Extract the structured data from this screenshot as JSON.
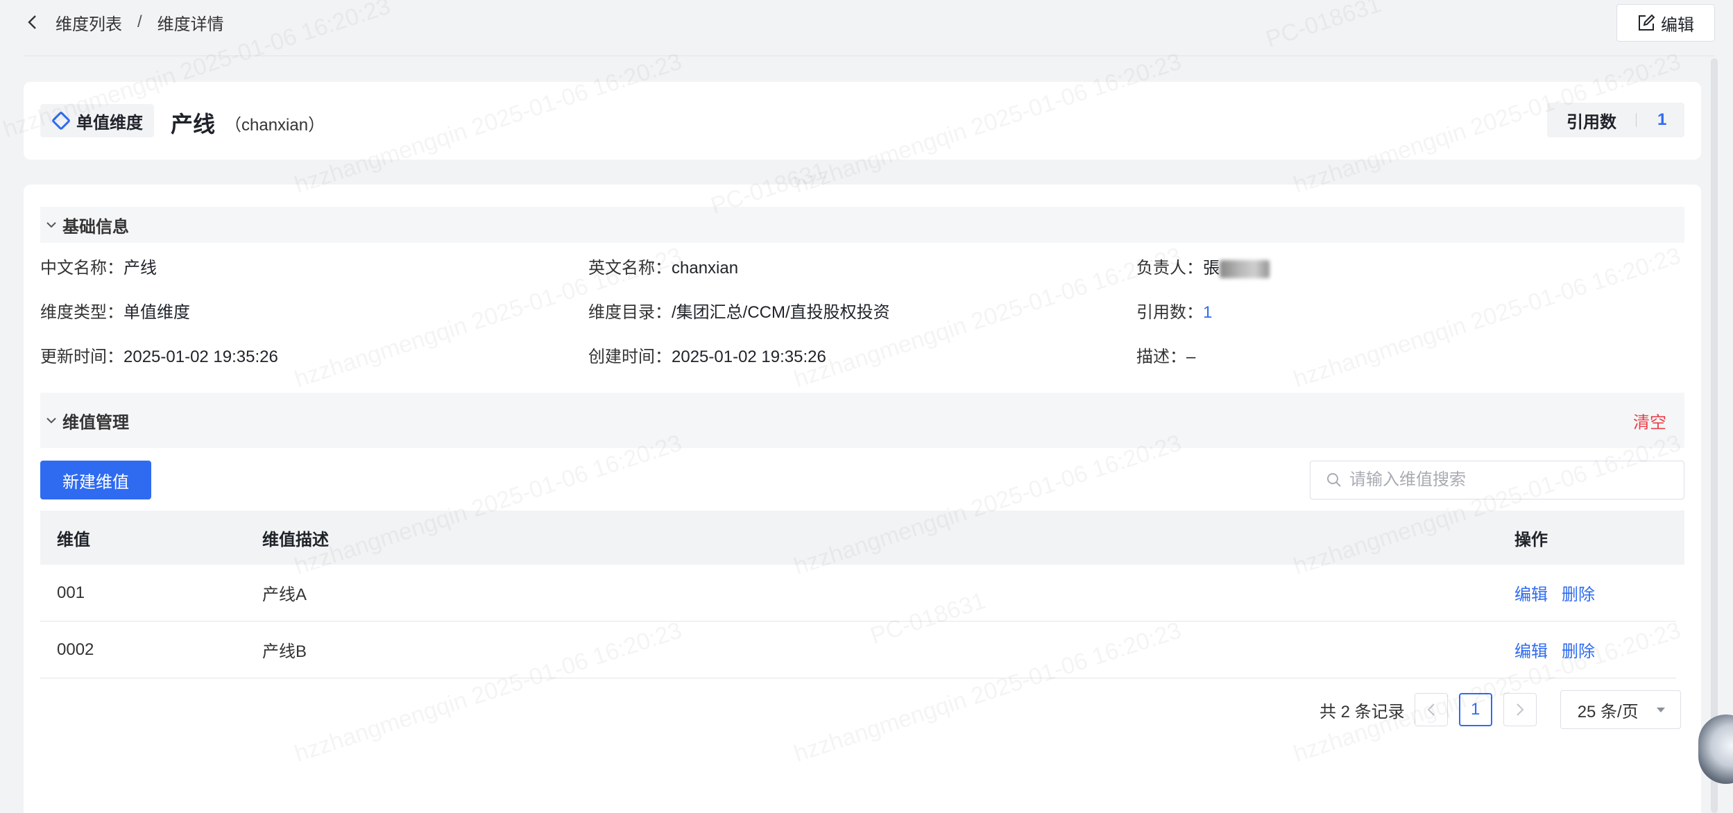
{
  "breadcrumb": {
    "parent": "维度列表",
    "separator": "/",
    "current": "维度详情"
  },
  "top_edit_label": "编辑",
  "header": {
    "type_tag": "单值维度",
    "name": "产线",
    "english_name": "（chanxian）",
    "ref_label": "引用数",
    "ref_value": "1"
  },
  "basic_info": {
    "title": "基础信息",
    "fields": {
      "cn_name_label": "中文名称：",
      "cn_name": "产线",
      "en_name_label": "英文名称：",
      "en_name": "chanxian",
      "owner_label": "负责人：",
      "owner_initial": "張",
      "type_label": "维度类型：",
      "type": "单值维度",
      "catalog_label": "维度目录：",
      "catalog": "/集团汇总/CCM/直投股权投资",
      "refs_label": "引用数：",
      "refs": "1",
      "updated_label": "更新时间：",
      "updated": "2025-01-02 19:35:26",
      "created_label": "创建时间：",
      "created": "2025-01-02 19:35:26",
      "desc_label": "描述：",
      "desc": "–"
    }
  },
  "values_section": {
    "title": "维值管理",
    "clear_label": "清空",
    "new_button": "新建维值",
    "search_placeholder": "请输入维值搜索",
    "columns": {
      "value": "维值",
      "desc": "维值描述",
      "ops": "操作"
    },
    "rows": [
      {
        "value": "001",
        "desc": "产线A",
        "edit": "编辑",
        "delete": "删除"
      },
      {
        "value": "0002",
        "desc": "产线B",
        "edit": "编辑",
        "delete": "删除"
      }
    ],
    "pagination": {
      "total_text": "共 2 条记录",
      "current_page": "1",
      "page_size": "25 条/页"
    }
  },
  "watermark": {
    "text": "hzzhangmengqin 2025-01-06 16:20:23",
    "id_text": "PC-018631"
  },
  "colors": {
    "primary": "#2f6bf0",
    "danger": "#e8404a",
    "bg": "#f2f3f5"
  }
}
